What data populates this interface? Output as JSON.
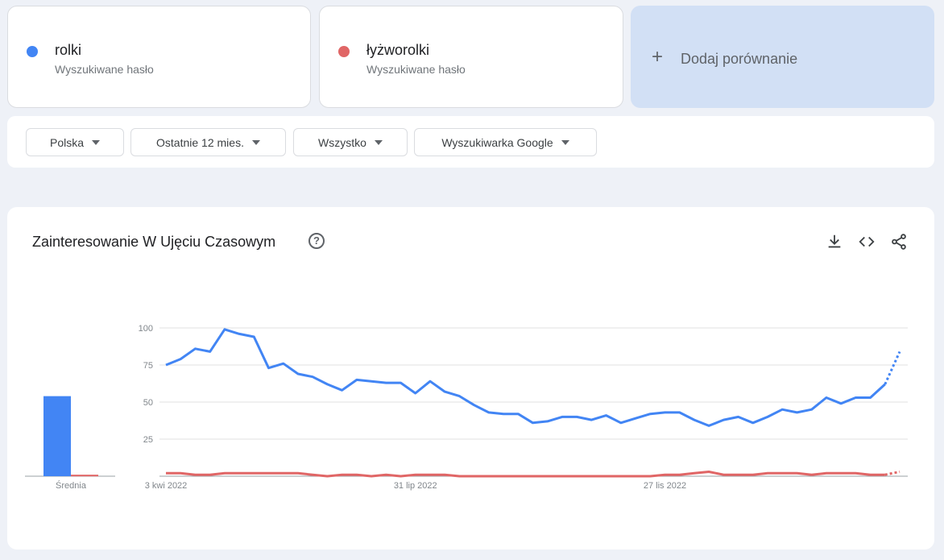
{
  "terms": [
    {
      "name": "rolki",
      "subtitle": "Wyszukiwane hasło",
      "color": "#4285f4"
    },
    {
      "name": "łyżworolki",
      "subtitle": "Wyszukiwane hasło",
      "color": "#e06666"
    }
  ],
  "add_compare": {
    "plus": "+",
    "label": "Dodaj porównanie"
  },
  "filters": {
    "region": "Polska",
    "period": "Ostatnie 12 mies.",
    "category": "Wszystko",
    "source": "Wyszukiwarka Google"
  },
  "chart": {
    "title": "Zainteresowanie W Ujęciu Czasowym",
    "help_icon": "help-circle-icon",
    "tools": [
      "download-icon",
      "embed-code-icon",
      "share-icon"
    ]
  },
  "chart_data": {
    "type": "line",
    "ylim": [
      0,
      100
    ],
    "yticks": [
      "100",
      "75",
      "50",
      "25"
    ],
    "xtick_labels": [
      {
        "label": "3 kwi 2022",
        "index": 0
      },
      {
        "label": "31 lip 2022",
        "index": 17
      },
      {
        "label": "27 lis 2022",
        "index": 34
      }
    ],
    "grid": true,
    "average_label": "Średnia",
    "averages": [
      {
        "name": "rolki",
        "value": 54
      },
      {
        "name": "łyżworolki",
        "value": 1
      }
    ],
    "partial_last_point": true,
    "series": [
      {
        "name": "rolki",
        "color": "#4285f4",
        "values": [
          75,
          79,
          86,
          84,
          99,
          96,
          94,
          73,
          76,
          69,
          67,
          62,
          58,
          65,
          64,
          63,
          63,
          56,
          64,
          57,
          54,
          48,
          43,
          42,
          42,
          36,
          37,
          40,
          40,
          38,
          41,
          36,
          39,
          42,
          43,
          43,
          38,
          34,
          38,
          40,
          36,
          40,
          45,
          43,
          45,
          53,
          49,
          53,
          53,
          62,
          84
        ]
      },
      {
        "name": "łyżworolki",
        "color": "#e06666",
        "values": [
          2,
          2,
          1,
          1,
          2,
          2,
          2,
          2,
          2,
          2,
          1,
          0,
          1,
          1,
          0,
          1,
          0,
          1,
          1,
          1,
          0,
          0,
          0,
          0,
          0,
          0,
          0,
          0,
          0,
          0,
          -1,
          0,
          0,
          0,
          1,
          1,
          2,
          3,
          1,
          1,
          1,
          2,
          2,
          2,
          1,
          2,
          2,
          2,
          1,
          1,
          3
        ]
      }
    ]
  }
}
